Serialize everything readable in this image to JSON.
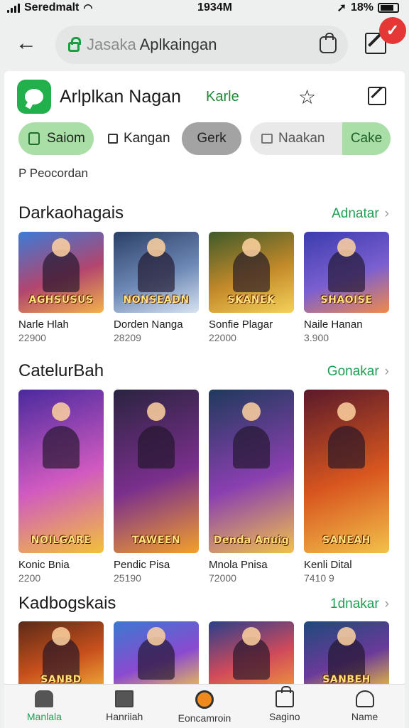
{
  "status": {
    "carrier": "Seredmalt",
    "time": "1934M",
    "battery": "18%"
  },
  "search": {
    "prefix": "Jasaka",
    "query": "Aplkaingan"
  },
  "notification": {
    "badge": "✓"
  },
  "app": {
    "name": "Arlplkan Nagan",
    "tag": "Karle"
  },
  "chips": [
    "Saiom",
    "Kangan",
    "Gerk",
    "Naakan",
    "Cake"
  ],
  "pre_label": "P Peocordan",
  "sections": [
    {
      "title": "Darkaohagais",
      "more": "Adnatar",
      "items": [
        {
          "title": "Narle Hlah",
          "value": "22900",
          "poster": "AGHSUSUS",
          "colors": [
            "#3c7bd6",
            "#b2456e",
            "#f2b24a"
          ]
        },
        {
          "title": "Dorden Nanga",
          "value": "28209",
          "poster": "NONSEADN",
          "colors": [
            "#2a3f66",
            "#6d88b5",
            "#d7e3f0"
          ]
        },
        {
          "title": "Sonfie Plagar",
          "value": "22000",
          "poster": "SKANEK",
          "colors": [
            "#3e5a2a",
            "#c48a2a",
            "#f4d25a"
          ]
        },
        {
          "title": "Naile Hanan",
          "value": "3.900",
          "poster": "SHAOISE",
          "colors": [
            "#3b3cae",
            "#7b5fd0",
            "#f08a4a"
          ]
        }
      ]
    },
    {
      "title": "CatelurBah",
      "more": "Gonakar",
      "items": [
        {
          "title": "Konic Bnia",
          "value": "2200",
          "poster": "NOILGARE",
          "colors": [
            "#4a2a9e",
            "#d05ac0",
            "#f2c13a"
          ]
        },
        {
          "title": "Pendic Pisa",
          "value": "25190",
          "poster": "TAWEEN",
          "colors": [
            "#2a2440",
            "#7a2f8c",
            "#f3a02a"
          ]
        },
        {
          "title": "Mnola Pnisa",
          "value": "72000",
          "poster": "Denda Anuig",
          "colors": [
            "#1f3a5c",
            "#8a3fb0",
            "#f0c24a"
          ]
        },
        {
          "title": "Kenli Dital",
          "value": "7410 9",
          "poster": "SANEAH",
          "colors": [
            "#5a1a2a",
            "#d8561f",
            "#f2c14a"
          ]
        }
      ]
    },
    {
      "title": "Kadbogskais",
      "more": "1dnakar",
      "items": [
        {
          "title": "",
          "value": "",
          "poster": "SANBD",
          "colors": [
            "#5a2a18",
            "#c8501c",
            "#f3b13a"
          ]
        },
        {
          "title": "",
          "value": "",
          "poster": "",
          "colors": [
            "#3a7ad0",
            "#8a4ad0",
            "#f2c84a"
          ]
        },
        {
          "title": "",
          "value": "",
          "poster": "",
          "colors": [
            "#2a3f8c",
            "#d04a5a",
            "#f09a3a"
          ]
        },
        {
          "title": "",
          "value": "",
          "poster": "SANBEH",
          "colors": [
            "#1e4a7a",
            "#6a3a9a",
            "#f0c43a"
          ]
        }
      ]
    }
  ],
  "nav": [
    {
      "label": "Manlala",
      "icon": "home-icon"
    },
    {
      "label": "Hanriiah",
      "icon": "mail-icon"
    },
    {
      "label": "Eoncamroin",
      "icon": "circle-icon"
    },
    {
      "label": "Sagino",
      "icon": "bag-icon"
    },
    {
      "label": "Name",
      "icon": "user-icon"
    }
  ],
  "colors": {
    "accent": "#1e9e52",
    "chip_green": "#a9dfa6",
    "brand": "#22b04d"
  }
}
